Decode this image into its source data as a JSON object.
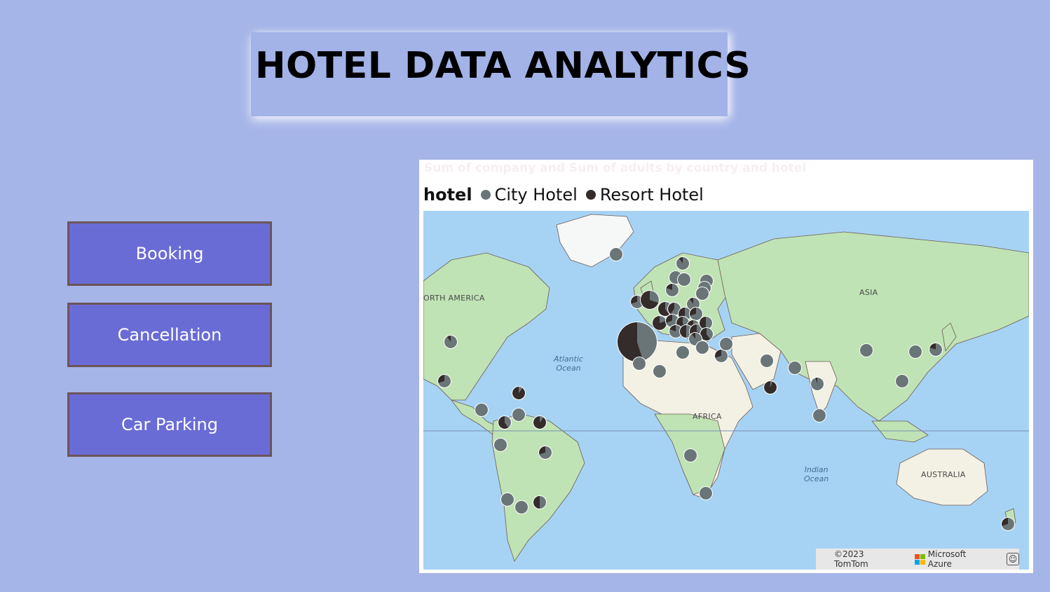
{
  "header": {
    "title": "HOTEL DATA ANALYTICS"
  },
  "nav": {
    "booking_label": "Booking",
    "cancellation_label": "Cancellation",
    "car_parking_label": "Car Parking"
  },
  "visual": {
    "title": "Sum of company and Sum of adults by country and hotel",
    "legend_title": "hotel",
    "legend_items": [
      {
        "label": "City Hotel",
        "color": "#6a7578"
      },
      {
        "label": "Resort Hotel",
        "color": "#342b2b"
      }
    ],
    "map_labels": {
      "north_america": "ORTH AMERICA",
      "asia": "ASIA",
      "africa": "AFRICA",
      "australia": "AUSTRALIA",
      "atlantic": "Atlantic\nOcean",
      "indian": "Indian\nOcean"
    },
    "attribution": {
      "copyright": "©2023 TomTom",
      "provider": "Microsoft Azure",
      "feedback_icon": "smiley-icon"
    }
  },
  "colors": {
    "background": "#a6b5e8",
    "button": "#6a6cd6",
    "button_border": "#6b5558",
    "city_hotel": "#6a7578",
    "resort_hotel": "#342b2b",
    "ocean": "#a6d3f4",
    "land": "#b8e0b0"
  }
}
